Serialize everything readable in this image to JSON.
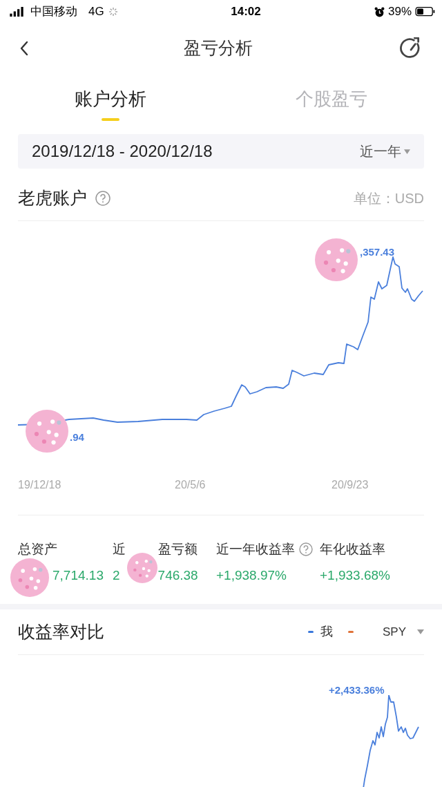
{
  "status_bar": {
    "carrier": "中国移动",
    "network": "4G",
    "time": "14:02",
    "battery": "39%"
  },
  "header": {
    "title": "盈亏分析"
  },
  "tabs": [
    {
      "label": "账户分析",
      "selected": true
    },
    {
      "label": "个股盈亏",
      "selected": false
    }
  ],
  "date_range": {
    "value": "2019/12/18 - 2020/12/18",
    "period": "近一年"
  },
  "account": {
    "title": "老虎账户",
    "unit": "单位：USD",
    "chart": {
      "annotations": [
        {
          "kind": "high",
          "text": ",357.43"
        },
        {
          "kind": "low",
          "text": ".94"
        }
      ],
      "x_labels": [
        "19/12/18",
        "20/5/6",
        "20/9/23"
      ]
    },
    "stats": [
      {
        "label": [
          "总资产"
        ],
        "value": [
          "7,714.13"
        ]
      },
      {
        "label": [
          "近",
          "盈亏额"
        ],
        "value": [
          "2",
          "746.38"
        ]
      },
      {
        "label": [
          "近一年收益率"
        ],
        "value": [
          "+1,938.97%"
        ],
        "help": true
      },
      {
        "label": [
          "年化收益率"
        ],
        "value": [
          "+1,933.68%"
        ]
      }
    ]
  },
  "comparison": {
    "title": "收益率对比",
    "legend": [
      {
        "label": "我",
        "color": "#3b78dc"
      },
      {
        "color": "#e0733a"
      }
    ],
    "benchmark": "SPY",
    "chart": {
      "annotations": [
        {
          "kind": "high",
          "text": "+2,433.36%"
        }
      ]
    }
  }
}
